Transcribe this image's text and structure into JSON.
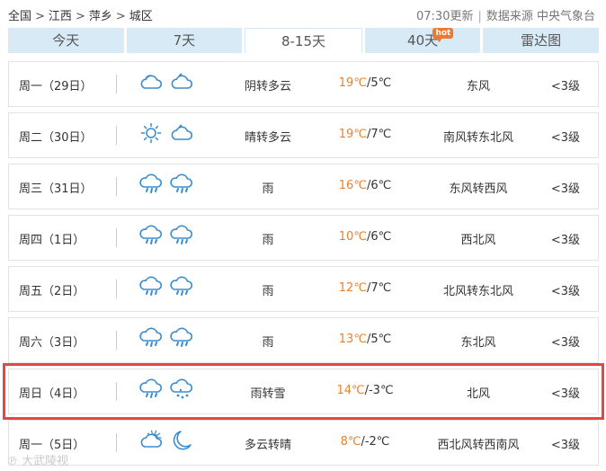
{
  "breadcrumb": {
    "items": [
      "全国",
      "江西",
      "萍乡",
      "城区"
    ]
  },
  "meta": {
    "update_time": "07:30更新",
    "source": "数据来源 中央气象台"
  },
  "tabs": [
    {
      "label": "今天",
      "active": false
    },
    {
      "label": "7天",
      "active": false
    },
    {
      "label": "8-15天",
      "active": true
    },
    {
      "label": "40天",
      "active": false,
      "badge": "hot"
    },
    {
      "label": "雷达图",
      "active": false
    }
  ],
  "forecast": [
    {
      "day": "周一（29日）",
      "icons": [
        "cloud-icon",
        "cloudy-night-icon"
      ],
      "desc": "阴转多云",
      "high": "19℃",
      "low": "5℃",
      "wind": "东风",
      "level": "<3级",
      "highlight": false
    },
    {
      "day": "周二（30日）",
      "icons": [
        "sun-icon",
        "cloudy-night-icon"
      ],
      "desc": "晴转多云",
      "high": "19℃",
      "low": "7℃",
      "wind": "南风转东北风",
      "level": "<3级",
      "highlight": false
    },
    {
      "day": "周三（31日）",
      "icons": [
        "rain-icon",
        "rain-icon"
      ],
      "desc": "雨",
      "high": "16℃",
      "low": "6℃",
      "wind": "东风转西风",
      "level": "<3级",
      "highlight": false
    },
    {
      "day": "周四（1日）",
      "icons": [
        "rain-icon",
        "rain-icon"
      ],
      "desc": "雨",
      "high": "10℃",
      "low": "6℃",
      "wind": "西北风",
      "level": "<3级",
      "highlight": false
    },
    {
      "day": "周五（2日）",
      "icons": [
        "rain-icon",
        "rain-icon"
      ],
      "desc": "雨",
      "high": "12℃",
      "low": "7℃",
      "wind": "北风转东北风",
      "level": "<3级",
      "highlight": false
    },
    {
      "day": "周六（3日）",
      "icons": [
        "rain-icon",
        "rain-icon"
      ],
      "desc": "雨",
      "high": "13℃",
      "low": "5℃",
      "wind": "东北风",
      "level": "<3级",
      "highlight": false
    },
    {
      "day": "周日（4日）",
      "icons": [
        "rain-icon",
        "snow-icon"
      ],
      "desc": "雨转雪",
      "high": "14℃",
      "low": "-3℃",
      "wind": "北风",
      "level": "<3级",
      "highlight": true
    },
    {
      "day": "周一（5日）",
      "icons": [
        "partly-cloudy-icon",
        "moon-icon"
      ],
      "desc": "多云转晴",
      "high": "8℃",
      "low": "-2℃",
      "wind": "西北风转西南风",
      "level": "<3级",
      "highlight": false
    }
  ],
  "watermark": "大武陵视",
  "colors": {
    "tab_bg": "#d7eaf6",
    "temp_high": "#e8822e",
    "icon_blue": "#3a8ccf",
    "highlight_border": "#e2474a"
  }
}
